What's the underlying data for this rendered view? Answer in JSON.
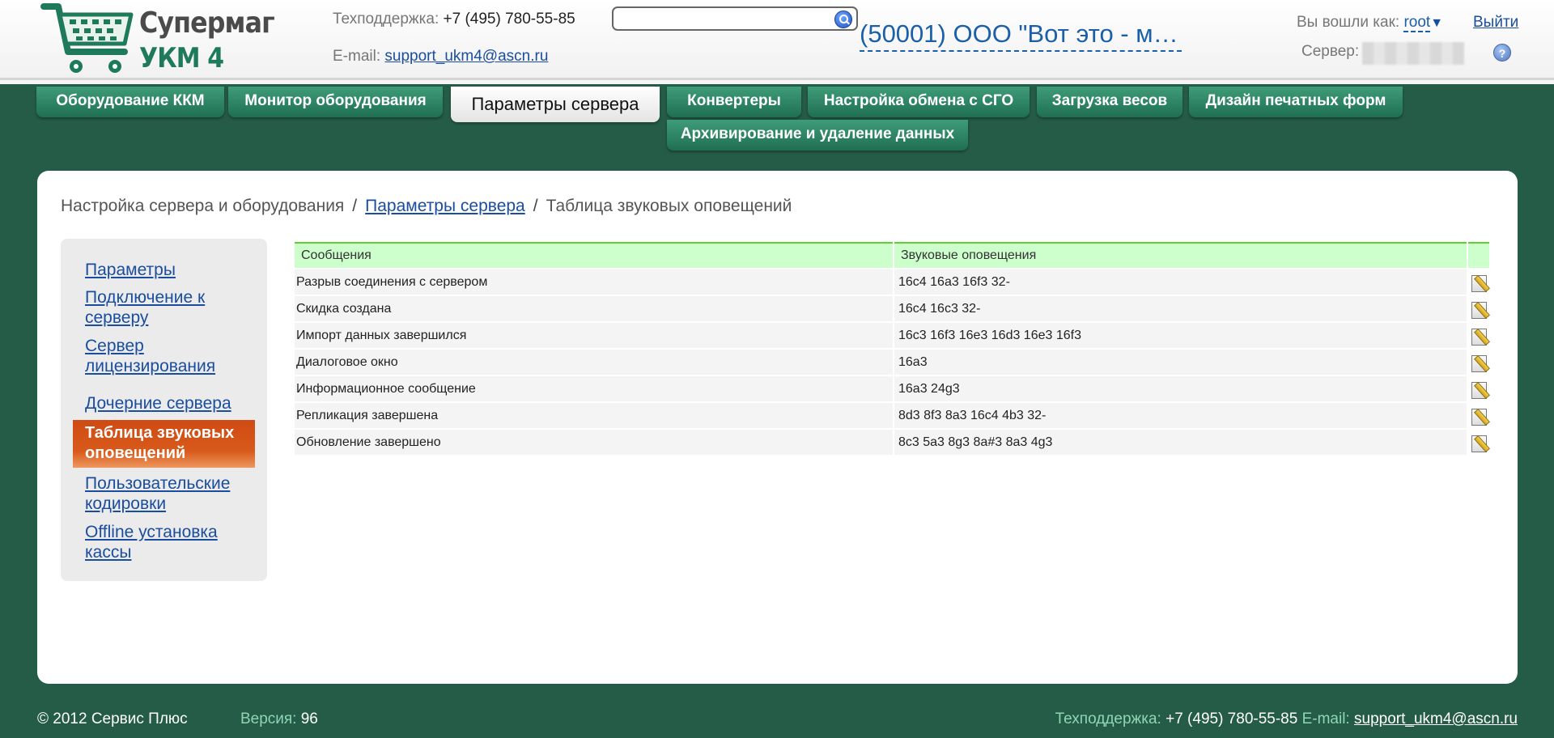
{
  "header": {
    "logo_line1": "Супермаг",
    "logo_line2": "УКМ 4",
    "support_label": "Техподдержка:",
    "support_phone": "+7 (495) 780-55-85",
    "email_label": "E-mail:",
    "email": "support_ukm4@ascn.ru",
    "search_value": "",
    "organization": "(50001) ООО \"Вот это - ма...",
    "login_label": "Вы вошли как:",
    "user": "root",
    "logout": "Выйти",
    "server_label": "Сервер:",
    "help": "?"
  },
  "tabs": [
    {
      "label": "Оборудование ККМ"
    },
    {
      "label": "Монитор оборудования"
    },
    {
      "label": "Параметры сервера"
    },
    {
      "label": "Конвертеры"
    },
    {
      "label": "Настройка обмена с СГО"
    },
    {
      "label": "Загрузка весов"
    },
    {
      "label": "Дизайн печатных форм"
    },
    {
      "label": "Архивирование и удаление данных"
    }
  ],
  "active_tab": "Параметры сервера",
  "breadcrumb": {
    "root": "Настройка сервера и оборудования",
    "sep": "/",
    "link": "Параметры сервера",
    "current": "Таблица звуковых оповещений"
  },
  "sidenav": [
    {
      "label": "Параметры"
    },
    {
      "label": "Подключение к серверу"
    },
    {
      "label": "Сервер лицензирования"
    },
    {
      "label": "Дочерние сервера"
    },
    {
      "label": "Таблица звуковых оповещений"
    },
    {
      "label": "Пользовательские кодировки"
    },
    {
      "label": "Offline установка кассы"
    }
  ],
  "sidenav_active": "Таблица звуковых оповещений",
  "table": {
    "columns": [
      "Сообщения",
      "Звуковые оповещения"
    ],
    "rows": [
      {
        "message": "Разрыв соединения с сервером",
        "sound": "16c4 16a3 16f3 32-"
      },
      {
        "message": "Скидка создана",
        "sound": "16c4 16c3 32-"
      },
      {
        "message": "Импорт данных завершился",
        "sound": "16c3 16f3 16e3 16d3 16e3 16f3"
      },
      {
        "message": "Диалоговое окно",
        "sound": "16a3"
      },
      {
        "message": "Информационное сообщение",
        "sound": "16a3 24g3"
      },
      {
        "message": "Репликация завершена",
        "sound": "8d3 8f3 8a3 16c4 4b3 32-"
      },
      {
        "message": "Обновление завершено",
        "sound": "8c3 5a3 8g3 8a#3 8a3 4g3"
      }
    ]
  },
  "footer": {
    "copyright": "© 2012 Сервис Плюс",
    "version_label": "Версия:",
    "version": "96",
    "support_label": "Техподдержка:",
    "support_phone": "+7 (495) 780-55-85",
    "email_label": "E-mail:",
    "email": "support_ukm4@ascn.ru"
  },
  "colors": {
    "background": "#255c48",
    "tab": "#2f8866",
    "active_nav": "#d85a1a",
    "table_header": "#ccffcc",
    "link": "#1a4d9e"
  }
}
